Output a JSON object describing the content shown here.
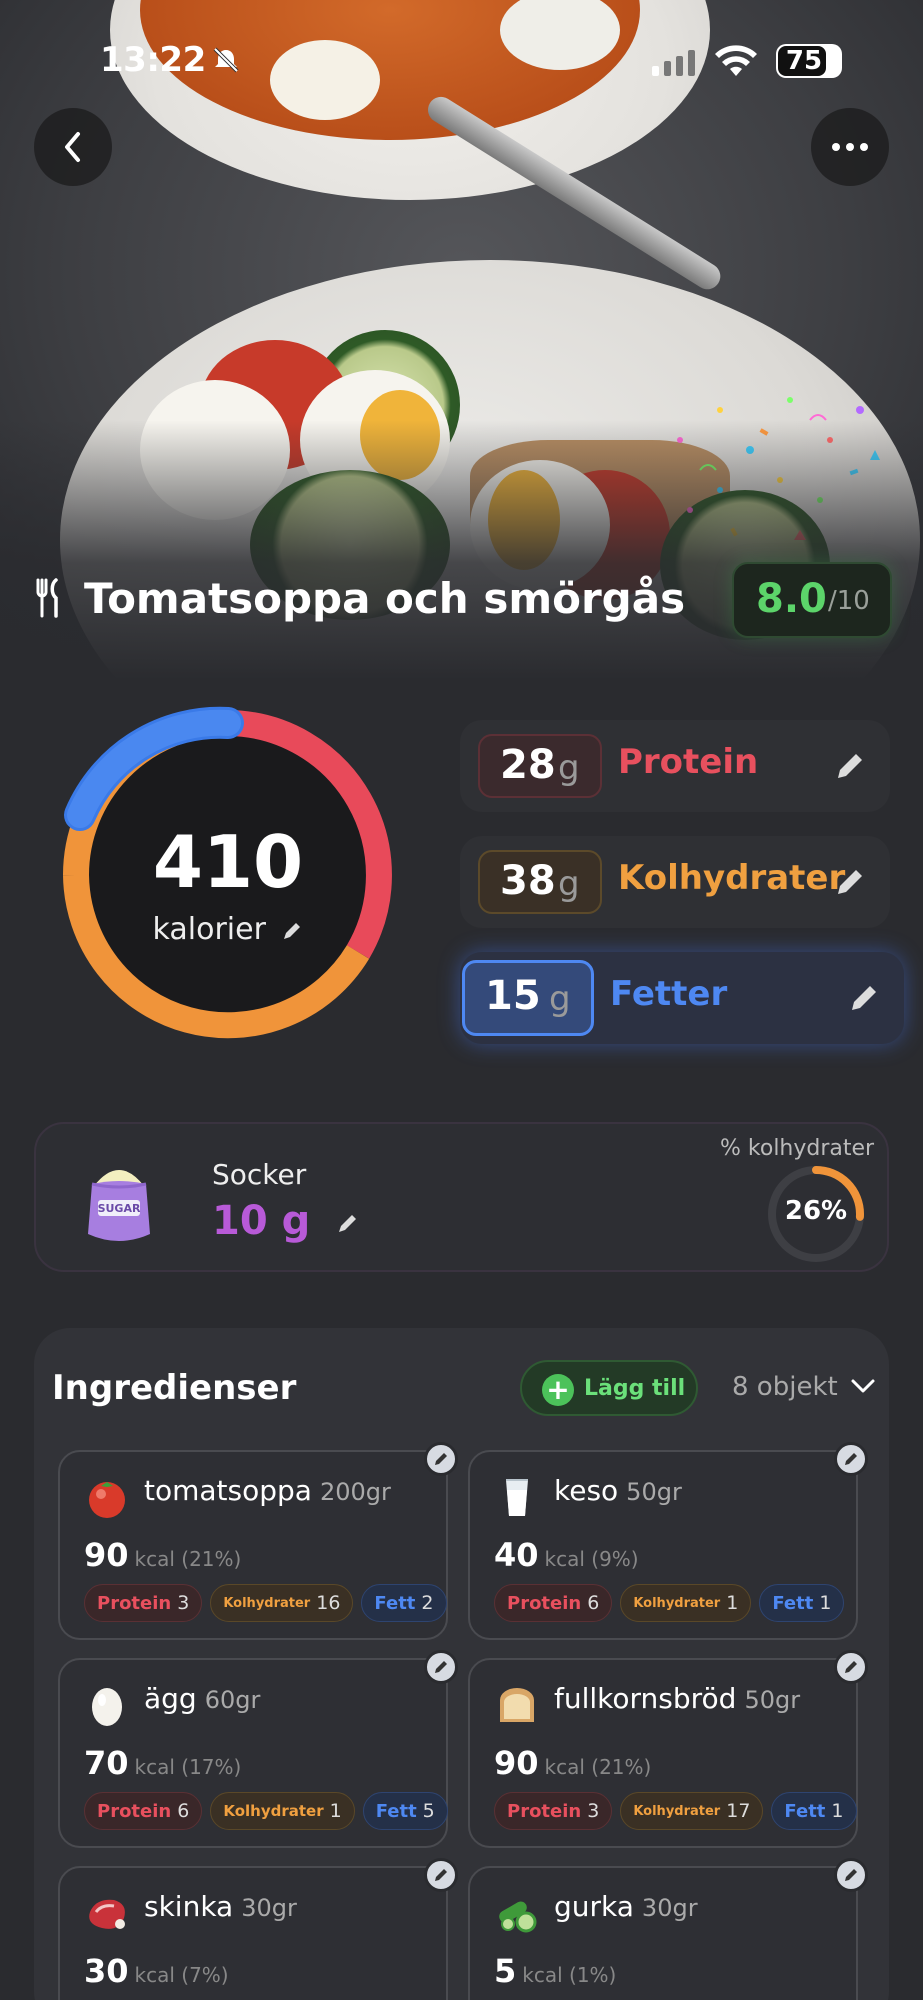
{
  "status_bar": {
    "time": "13:22",
    "battery": "75"
  },
  "meal": {
    "title": "Tomatsoppa och smörgås",
    "score": "8.0",
    "score_max": "/10"
  },
  "calories": {
    "value": "410",
    "label": "kalorier"
  },
  "macros": [
    {
      "value": "28",
      "unit": "g",
      "name": "Protein",
      "color": "#e8505e"
    },
    {
      "value": "38",
      "unit": "g",
      "name": "Kolhydrater",
      "color": "#f0a040"
    },
    {
      "value": "15",
      "unit": "g",
      "name": "Fetter",
      "color": "#4e88f2"
    }
  ],
  "sugar": {
    "label": "Socker",
    "value": "10 g",
    "pct_label": "% kolhydrater",
    "pct": "26%",
    "pct_fraction": 0.26,
    "bag_text": "SUGAR"
  },
  "ingredients": {
    "title": "Ingredienser",
    "add_label": "Lägg till",
    "count": "8 objekt",
    "items": [
      {
        "name": "tomatsoppa",
        "grams": "200gr",
        "kcal": "90",
        "kcal_sub": "kcal (21%)",
        "protein_label": "Protein",
        "protein": "3",
        "carb_label": "Kolhydrater",
        "carb": "16",
        "fat_label": "Fett",
        "fat": "2",
        "icon": "tomato-icon"
      },
      {
        "name": "keso",
        "grams": "50gr",
        "kcal": "40",
        "kcal_sub": "kcal (9%)",
        "protein_label": "Protein",
        "protein": "6",
        "carb_label": "Kolhydrater",
        "carb": "1",
        "fat_label": "Fett",
        "fat": "1",
        "icon": "milk-icon"
      },
      {
        "name": "ägg",
        "grams": "60gr",
        "kcal": "70",
        "kcal_sub": "kcal (17%)",
        "protein_label": "Protein",
        "protein": "6",
        "carb_label": "Kolhydrater",
        "carb": "1",
        "fat_label": "Fett",
        "fat": "5",
        "icon": "egg-icon"
      },
      {
        "name": "fullkornsbröd",
        "grams": "50gr",
        "kcal": "90",
        "kcal_sub": "kcal (21%)",
        "protein_label": "Protein",
        "protein": "3",
        "carb_label": "Kolhydrater",
        "carb": "17",
        "fat_label": "Fett",
        "fat": "1",
        "icon": "bread-icon"
      },
      {
        "name": "skinka",
        "grams": "30gr",
        "kcal": "30",
        "kcal_sub": "kcal (7%)",
        "icon": "ham-icon"
      },
      {
        "name": "gurka",
        "grams": "30gr",
        "kcal": "5",
        "kcal_sub": "kcal (1%)",
        "icon": "cucumber-icon"
      }
    ]
  }
}
